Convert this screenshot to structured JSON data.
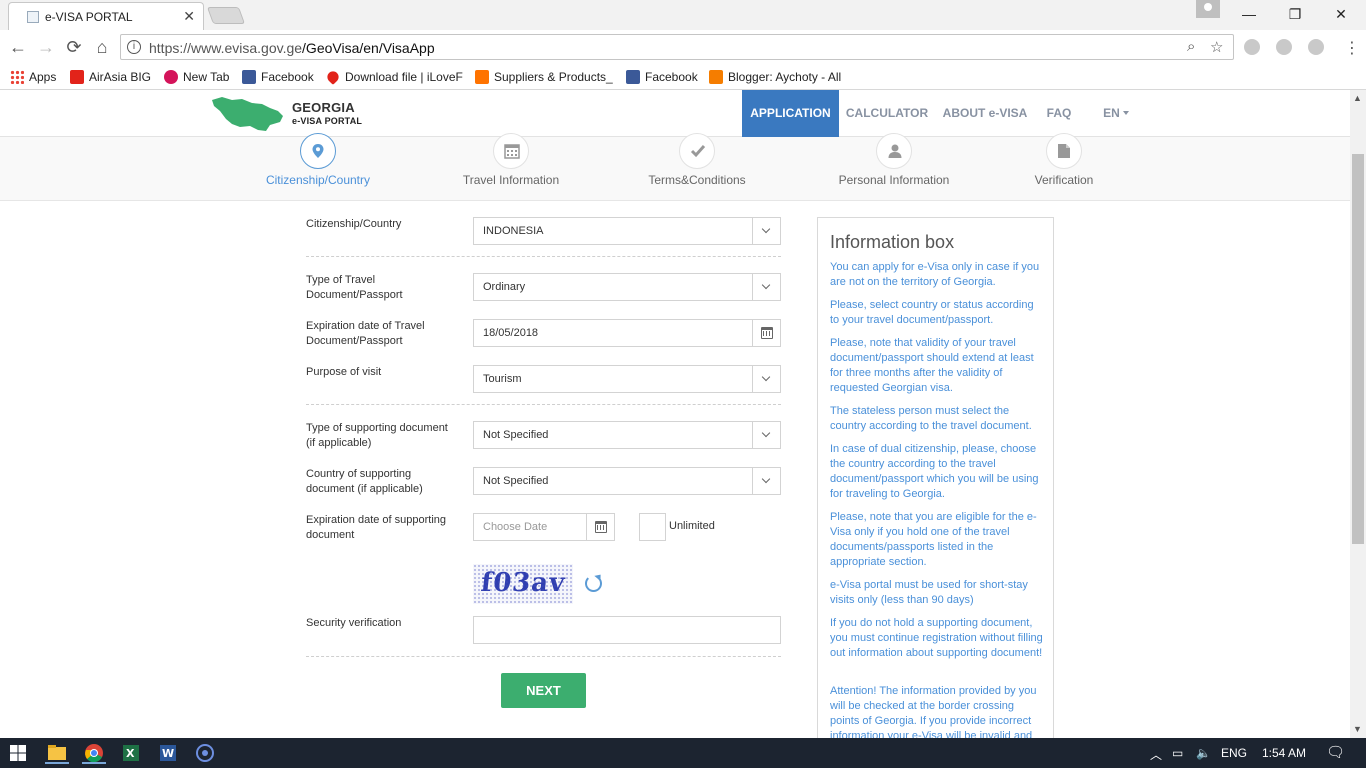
{
  "browser": {
    "tab_title": "e-VISA PORTAL",
    "tab_close": "✕",
    "url_host": "https://www.evisa.gov.ge",
    "url_path": "/GeoVisa/en/VisaApp",
    "window_minimize": "—",
    "window_restore": "❐",
    "window_close": "✕"
  },
  "bookmarks": [
    {
      "label": "Apps",
      "icon": "apps-grid-icon"
    },
    {
      "label": "AirAsia BIG",
      "icon": "airasia-icon",
      "color": "#e2231a"
    },
    {
      "label": "New Tab",
      "icon": "new-tab-icon",
      "color": "#d4145a"
    },
    {
      "label": "Facebook",
      "icon": "facebook-icon",
      "color": "#3b5998"
    },
    {
      "label": "Download file | iLoveF",
      "icon": "heart-icon",
      "color": "#e2231a"
    },
    {
      "label": "Suppliers & Products_",
      "icon": "alibaba-icon",
      "color": "#ff7300"
    },
    {
      "label": "Facebook",
      "icon": "facebook-icon",
      "color": "#3b5998"
    },
    {
      "label": "Blogger: Aychoty - All",
      "icon": "blogger-icon",
      "color": "#f57d00"
    }
  ],
  "site": {
    "logo_title": "GEORGIA",
    "logo_subtitle": "e-VISA PORTAL",
    "nav": [
      "APPLICATION",
      "CALCULATOR",
      "ABOUT e-VISA",
      "FAQ",
      "EN"
    ],
    "brand_color": "#3a79c0"
  },
  "steps": [
    {
      "label": "Citizenship/Country",
      "icon": "map-pin-icon",
      "active": true
    },
    {
      "label": "Travel Information",
      "icon": "calendar-icon",
      "active": false
    },
    {
      "label": "Terms&Conditions",
      "icon": "checkmark-icon",
      "active": false
    },
    {
      "label": "Personal Information",
      "icon": "user-icon",
      "active": false
    },
    {
      "label": "Verification",
      "icon": "document-icon",
      "active": false
    }
  ],
  "form": {
    "citizenship_label": "Citizenship/Country",
    "citizenship_value": "INDONESIA",
    "doc_type_label": "Type of Travel Document/Passport",
    "doc_type_value": "Ordinary",
    "doc_expiry_label": "Expiration date of Travel Document/Passport",
    "doc_expiry_value": "18/05/2018",
    "purpose_label": "Purpose of visit",
    "purpose_value": "Tourism",
    "support_type_label": "Type of supporting document (if applicable)",
    "support_type_value": "Not Specified",
    "support_country_label": "Country of supporting document (if applicable)",
    "support_country_value": "Not Specified",
    "support_expiry_label": "Expiration date of supporting document",
    "support_expiry_placeholder": "Choose Date",
    "unlimited_label": "Unlimited",
    "captcha_text": "f03av",
    "security_label": "Security verification",
    "security_value": "",
    "next_label": "NEXT",
    "next_color": "#3cae6f"
  },
  "infobox": {
    "title": "Information box",
    "paragraphs": [
      "You can apply for e-Visa only in case if you are not on the territory of Georgia.",
      "Please, select country or status according to your travel document/passport.",
      "Please, note that validity of your travel document/passport should extend at least for three months after the validity of requested Georgian visa.",
      "The stateless person must select the country according to the travel document.",
      "In case of dual citizenship, please, choose the country according to the travel document/passport which you will be using for traveling to Georgia.",
      "Please, note that you are eligible for the e-Visa only if you hold one of the travel documents/passports listed in the appropriate section.",
      "e-Visa portal must be used for short-stay visits only (less than 90 days)",
      "If you do not hold a supporting document, you must continue registration without filling out information about supporting document!",
      "Attention! The information provided by you will be checked at the border crossing points of Georgia. If you provide incorrect information your e-Visa will be invalid and"
    ],
    "text_color": "#4a90d9"
  },
  "taskbar": {
    "language": "ENG",
    "time": "1:54 AM"
  }
}
